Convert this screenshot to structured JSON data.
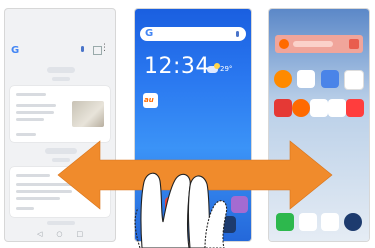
{
  "left_phone": {
    "status": {
      "left": "",
      "right": ""
    },
    "google_letter": "G",
    "menu_glyph": "⋮",
    "nav": {
      "back": "◁",
      "home": "○",
      "recent": "□"
    }
  },
  "middle_phone": {
    "status": {
      "left": "",
      "right": ""
    },
    "search_letter": "G",
    "clock": "12:34",
    "clock_small": "",
    "date": "",
    "temperature": "29°",
    "au_label": "au",
    "au_caption": ""
  },
  "right_phone": {
    "status": {
      "left": "",
      "right": ""
    }
  },
  "colors": {
    "arrow": "#f08b2c",
    "middle_wallpaper": "#2a78f0"
  }
}
